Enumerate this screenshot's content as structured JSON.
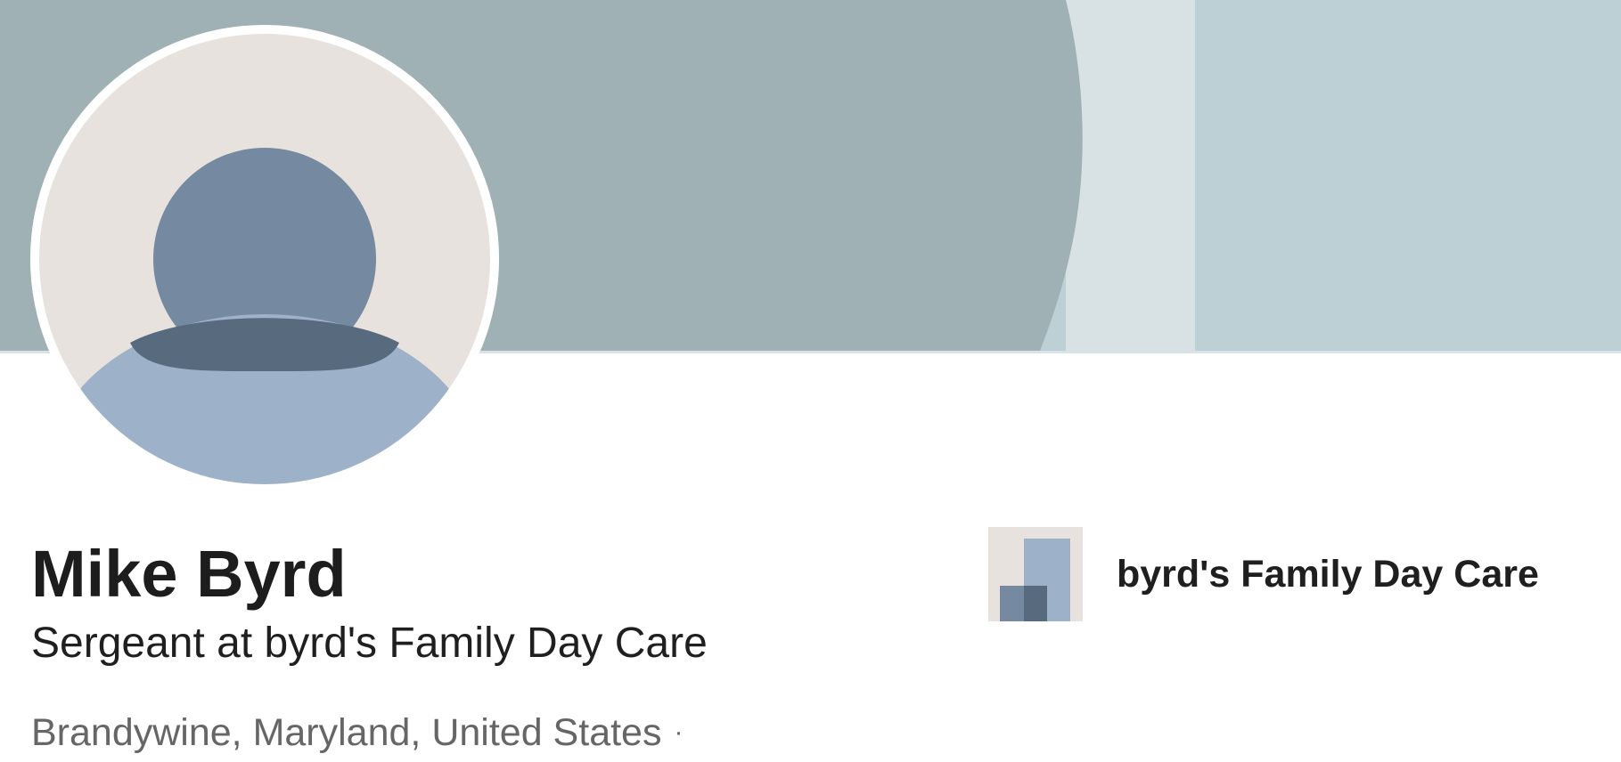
{
  "profile": {
    "name": "Mike Byrd",
    "headline": "Sergeant at byrd's Family Day Care",
    "location": "Brandywine, Maryland, United States",
    "location_separator": "·"
  },
  "company": {
    "name": "byrd's Family Day Care"
  },
  "icons": {
    "avatar": "default-person-avatar-icon",
    "company_logo": "company-building-logo-icon"
  },
  "colors": {
    "cover_main": "#a0b1b5",
    "cover_stripe": "#d8e2e5",
    "cover_right": "#bdd0d5",
    "avatar_background": "#e7e2de",
    "avatar_head": "#7589a1",
    "avatar_body": "#9db2c9"
  }
}
